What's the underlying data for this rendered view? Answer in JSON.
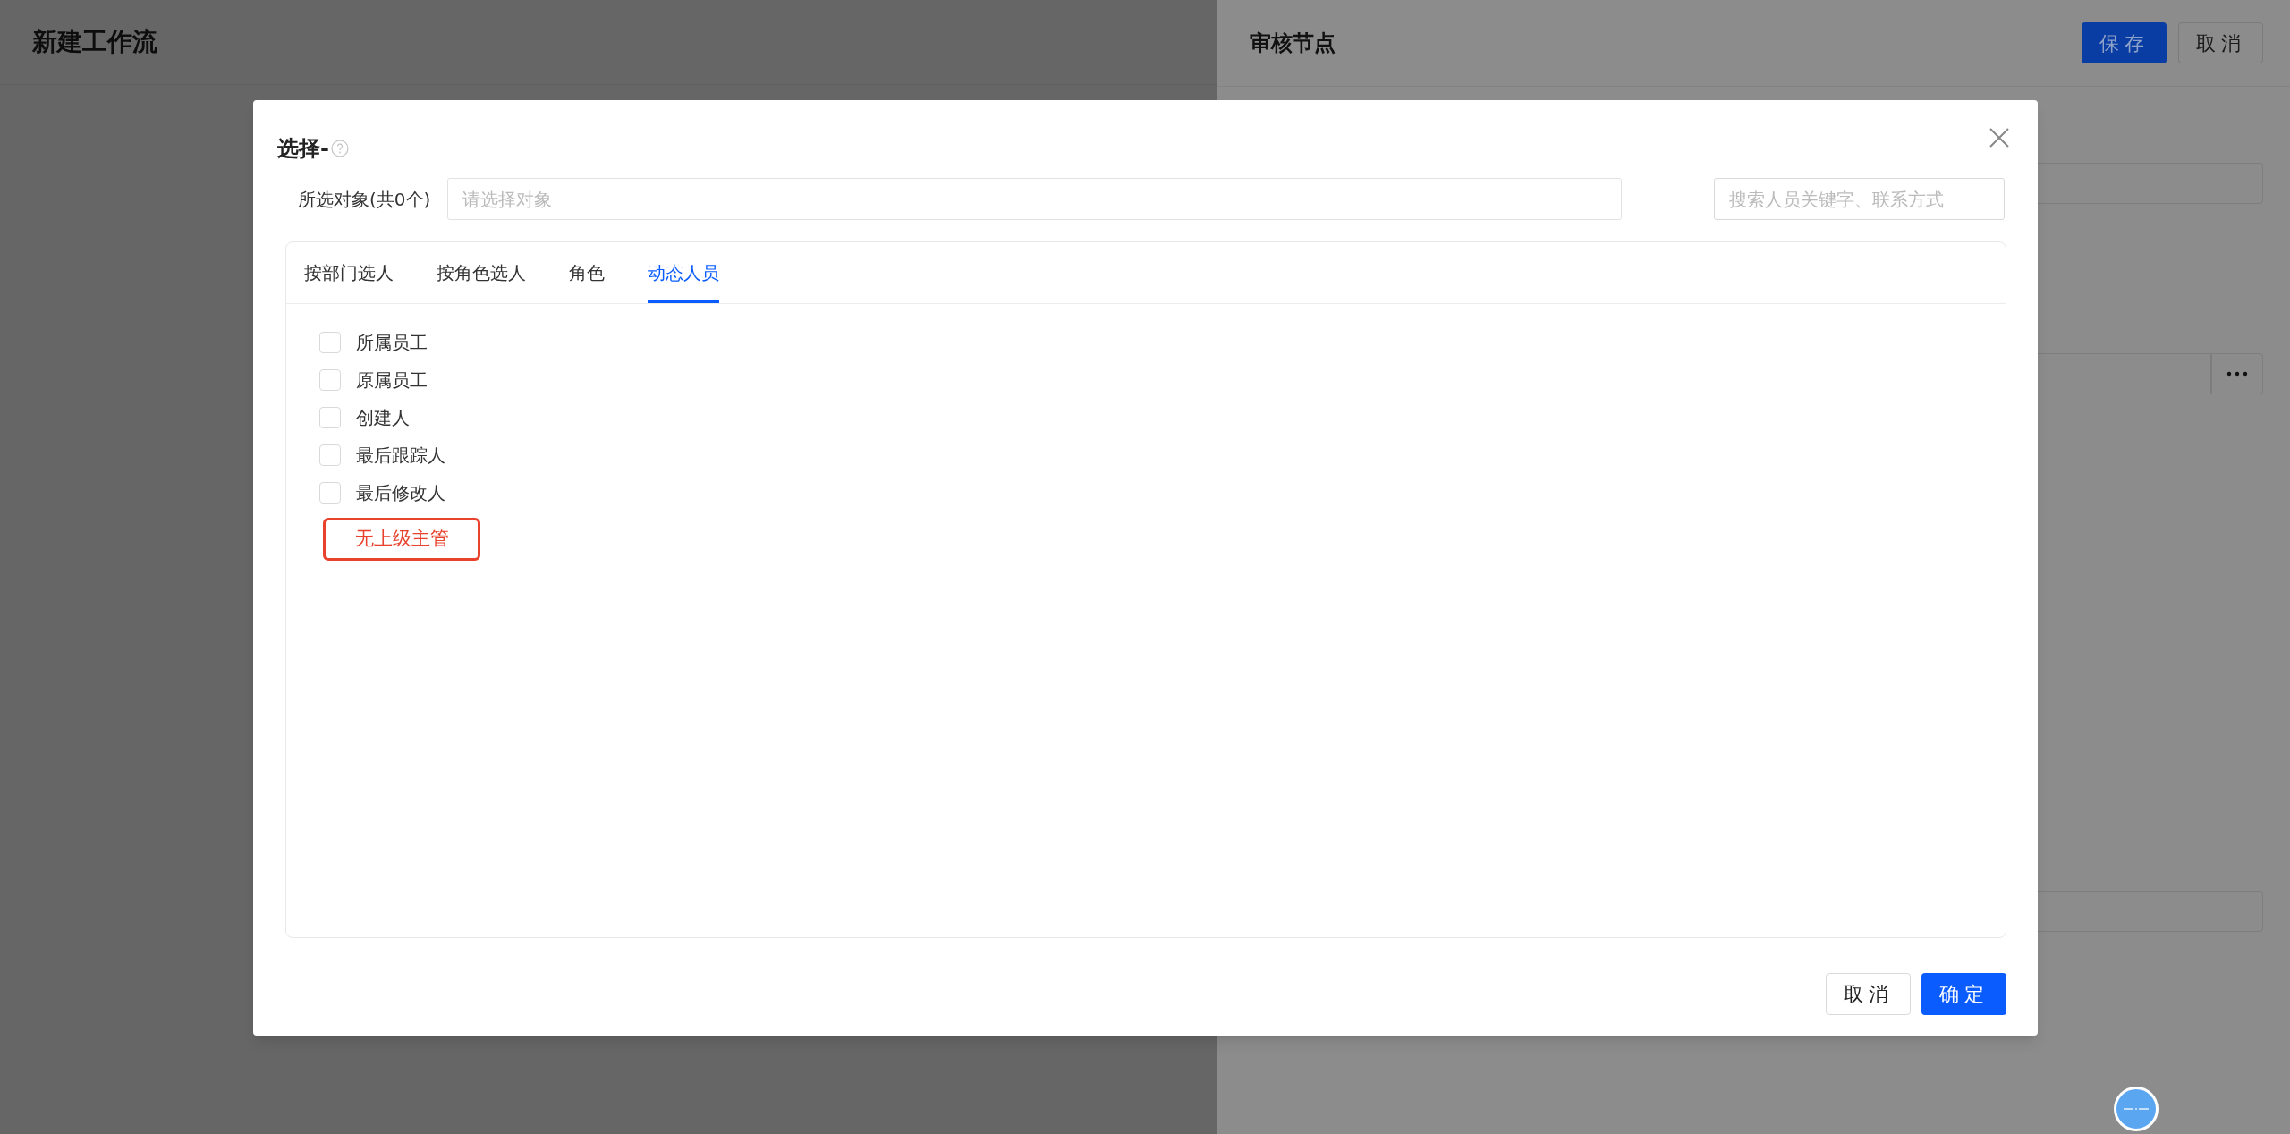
{
  "page": {
    "title": "新建工作流"
  },
  "side_panel": {
    "title": "审核节点",
    "buttons": [
      {
        "label": "保存",
        "kind": "primary"
      },
      {
        "label": "取消",
        "kind": "default"
      }
    ]
  },
  "dialog": {
    "title": "选择-",
    "selected_label": "所选对象(共0个)",
    "selected_placeholder": "请选择对象",
    "search_placeholder": "搜索人员关键字、联系方式",
    "tabs": [
      {
        "label": "按部门选人",
        "selected": false
      },
      {
        "label": "按角色选人",
        "selected": false
      },
      {
        "label": "角色",
        "selected": false
      },
      {
        "label": "动态人员",
        "selected": true
      }
    ],
    "options": [
      {
        "label": "所属员工",
        "kind": "checkbox",
        "checked": false
      },
      {
        "label": "原属员工",
        "kind": "checkbox",
        "checked": false
      },
      {
        "label": "创建人",
        "kind": "checkbox",
        "checked": false
      },
      {
        "label": "最后跟踪人",
        "kind": "checkbox",
        "checked": false
      },
      {
        "label": "最后修改人",
        "kind": "checkbox",
        "checked": false
      },
      {
        "label": "无上级主管",
        "kind": "highlighted"
      }
    ],
    "buttons": [
      {
        "label": "取消",
        "kind": "default"
      },
      {
        "label": "确定",
        "kind": "primary"
      }
    ]
  }
}
